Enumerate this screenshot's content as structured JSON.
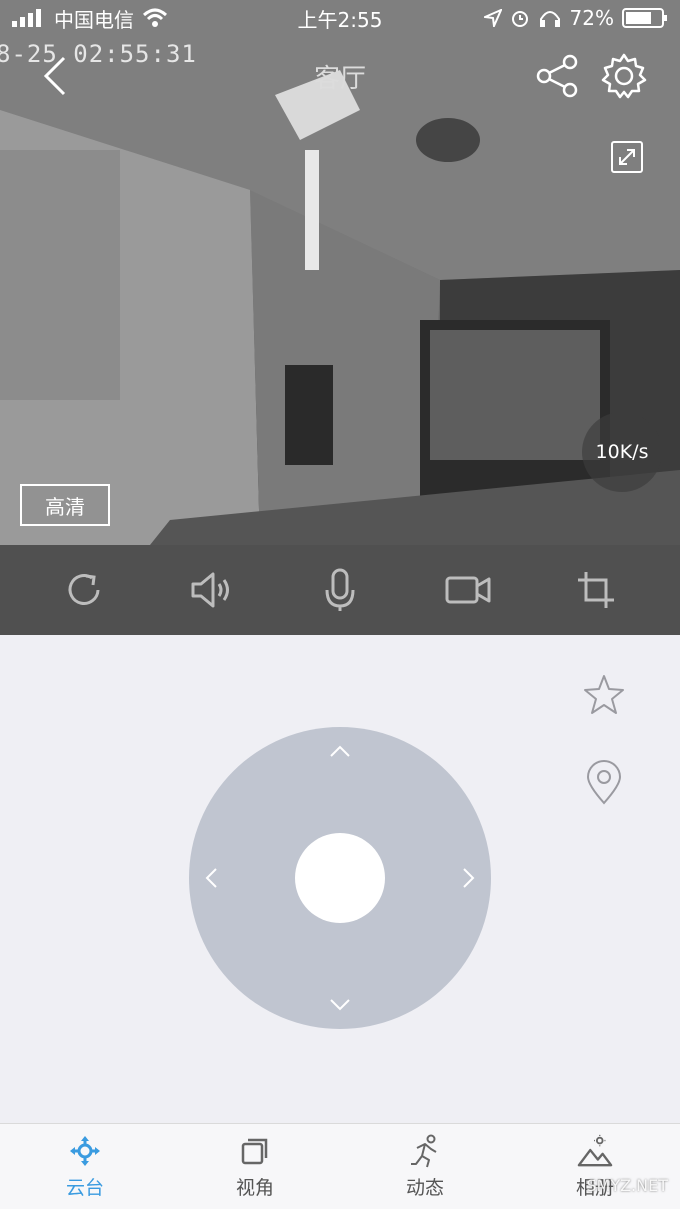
{
  "status_bar": {
    "carrier": "中国电信",
    "time": "上午2:55",
    "battery": "72%"
  },
  "video": {
    "timestamp": "8-25 02:55:31",
    "title": "客厅",
    "speed": "10K/s",
    "quality": "高清"
  },
  "toolbar": {
    "icons": [
      "refresh-icon",
      "speaker-icon",
      "microphone-icon",
      "video-record-icon",
      "crop-icon"
    ]
  },
  "tabs": [
    {
      "label": "云台",
      "icon": "ptz-icon",
      "active": true
    },
    {
      "label": "视角",
      "icon": "view-icon",
      "active": false
    },
    {
      "label": "动态",
      "icon": "motion-icon",
      "active": false
    },
    {
      "label": "相册",
      "icon": "album-icon",
      "active": false
    }
  ],
  "watermark": "SMYZ.NET",
  "colors": {
    "accent": "#3a9be0",
    "toolbar_bg": "#505050",
    "ptz_pad": "#c0c5d0"
  }
}
